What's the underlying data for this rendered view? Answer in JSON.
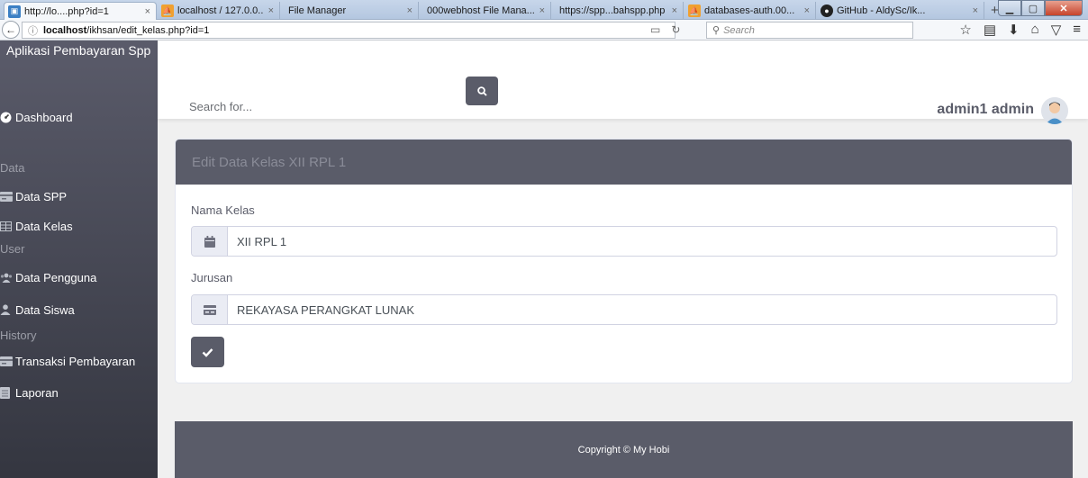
{
  "browser": {
    "tabs": [
      {
        "label": "http://lo....php?id=1",
        "icon": "page-icon",
        "active": true
      },
      {
        "label": "localhost / 127.0.0....",
        "icon": "phpmyadmin-icon",
        "active": false
      },
      {
        "label": "File Manager",
        "icon": "none",
        "active": false
      },
      {
        "label": "000webhost File Mana...",
        "icon": "none",
        "active": false
      },
      {
        "label": "https://spp...bahspp.php",
        "icon": "none",
        "active": false
      },
      {
        "label": "databases-auth.00...",
        "icon": "phpmyadmin-icon",
        "active": false
      },
      {
        "label": "GitHub - AldySc/Ik...",
        "icon": "github-icon",
        "active": false
      }
    ],
    "close_glyph": "×",
    "new_tab_glyph": "+",
    "url_host": "localhost",
    "url_path": "/ikhsan/edit_kelas.php?id=1",
    "search_placeholder": "Search"
  },
  "sidebar": {
    "brand": "Aplikasi Pembayaran Spp",
    "dashboard": "Dashboard",
    "heading_data": "Data",
    "data_spp": "Data SPP",
    "data_kelas": "Data Kelas",
    "heading_user": "User",
    "data_pengguna": "Data Pengguna",
    "data_siswa": "Data Siswa",
    "heading_history": "History",
    "transaksi": "Transaksi Pembayaran",
    "laporan": "Laporan"
  },
  "topbar": {
    "search_placeholder": "Search for...",
    "username": "admin1 admin"
  },
  "card": {
    "title": "Edit Data Kelas XII RPL 1",
    "nama_kelas_label": "Nama Kelas",
    "nama_kelas_value": "XII RPL 1",
    "jurusan_label": "Jurusan",
    "jurusan_value": "REKAYASA PERANGKAT LUNAK"
  },
  "footer": {
    "copyright": "Copyright © My Hobi"
  },
  "colors": {
    "primary_dark": "#5a5c69",
    "sidebar_top": "#5a5b6a",
    "sidebar_bottom": "#343640"
  }
}
